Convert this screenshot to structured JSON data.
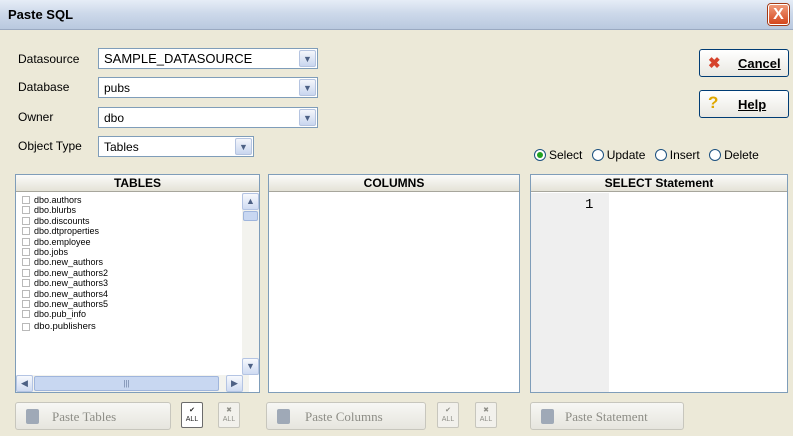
{
  "window": {
    "title": "Paste SQL",
    "close_glyph": "X"
  },
  "form": {
    "datasource": {
      "label": "Datasource",
      "value": "SAMPLE_DATASOURCE"
    },
    "database": {
      "label": "Database",
      "value": "pubs"
    },
    "owner": {
      "label": "Owner",
      "value": "dbo"
    },
    "object_type": {
      "label": "Object Type",
      "value": "Tables"
    }
  },
  "buttons": {
    "cancel": {
      "label": "Cancel",
      "icon": "x-icon"
    },
    "help": {
      "label": "Help",
      "icon": "question-icon"
    }
  },
  "statement_type": {
    "options": [
      "Select",
      "Update",
      "Insert",
      "Delete"
    ],
    "selected": "Select"
  },
  "panels": {
    "tables_header": "TABLES",
    "columns_header": "COLUMNS",
    "statement_header": "SELECT Statement",
    "line_number": "1"
  },
  "tables": [
    "dbo.authors",
    "dbo.blurbs",
    "dbo.discounts",
    "dbo.dtproperties",
    "dbo.employee",
    "dbo.jobs",
    "dbo.new_authors",
    "dbo.new_authors2",
    "dbo.new_authors3",
    "dbo.new_authors4",
    "dbo.new_authors5",
    "dbo.pub_info",
    "dbo.publishers"
  ],
  "bottom": {
    "paste_tables": "Paste Tables",
    "paste_columns": "Paste Columns",
    "paste_statement": "Paste Statement",
    "all_label": "ALL"
  }
}
